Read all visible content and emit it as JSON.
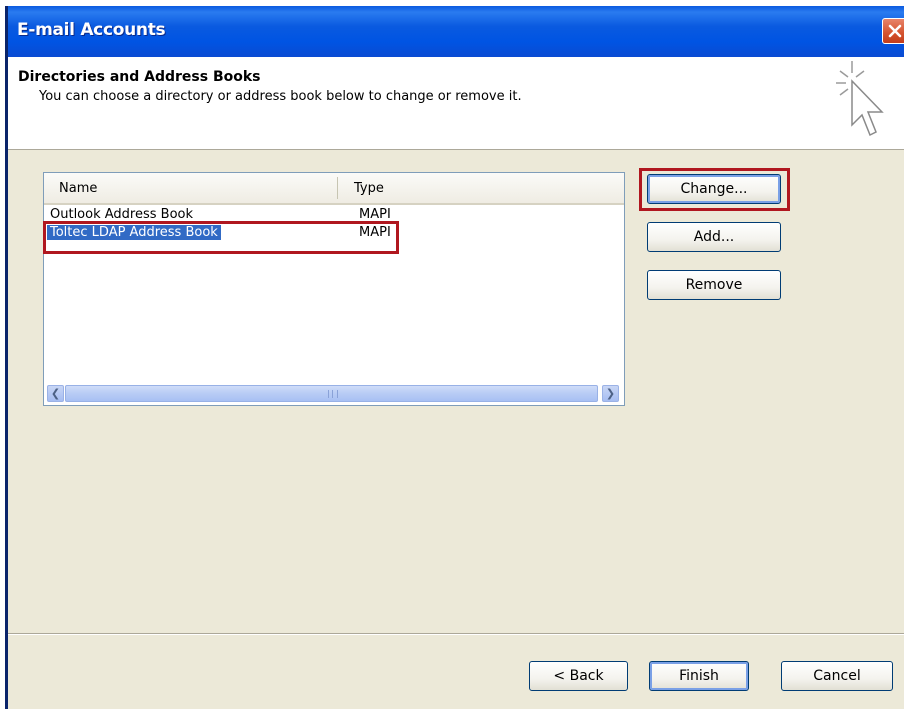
{
  "window": {
    "title": "E-mail Accounts"
  },
  "header": {
    "title": "Directories and Address Books",
    "subtitle": "You can choose a directory or address book below to change or remove it."
  },
  "list": {
    "columns": [
      "Name",
      "Type"
    ],
    "rows": [
      {
        "name": "Outlook Address Book",
        "type": "MAPI",
        "selected": false
      },
      {
        "name": "Toltec LDAP Address Book",
        "type": "MAPI",
        "selected": true
      }
    ]
  },
  "side_buttons": {
    "change": "Change...",
    "add": "Add...",
    "remove": "Remove"
  },
  "footer_buttons": {
    "back": "< Back",
    "finish": "Finish",
    "cancel": "Cancel"
  },
  "colors": {
    "title_bar": "#0054e3",
    "selection": "#316ac5",
    "highlight_box": "#b0171f",
    "dialog_bg": "#ece9d8"
  }
}
